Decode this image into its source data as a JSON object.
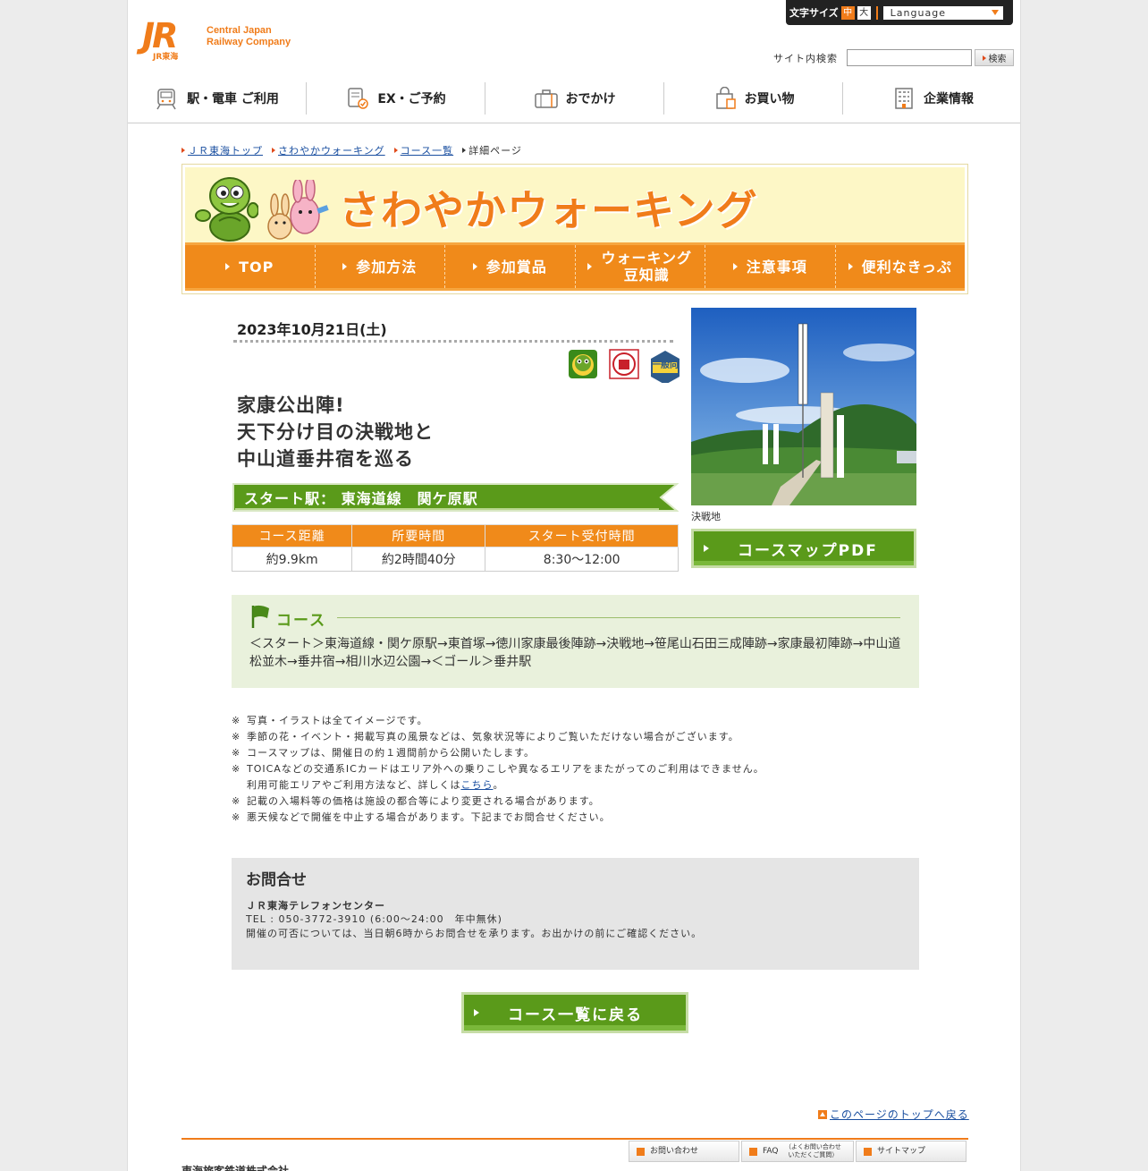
{
  "header": {
    "logo_text_line1": "Central Japan",
    "logo_text_line2": "Railway Company",
    "logo_jr": "JR",
    "logo_small": "JR東海",
    "font_size_label": "文字サイズ",
    "font_size_mid": "中",
    "font_size_large": "大",
    "language_label": "Language",
    "search_label": "サイト内検索",
    "search_value": "",
    "search_button": "検索"
  },
  "global_nav": [
    {
      "label": "駅・電車 ご利用",
      "icon": "train-icon"
    },
    {
      "label": "EX・ご予約",
      "icon": "reservation-icon"
    },
    {
      "label": "おでかけ",
      "icon": "suitcase-icon"
    },
    {
      "label": "お買い物",
      "icon": "shopping-bag-icon"
    },
    {
      "label": "企業情報",
      "icon": "building-icon"
    }
  ],
  "breadcrumb": [
    {
      "label": "ＪＲ東海トップ",
      "link": true
    },
    {
      "label": "さわやかウォーキング",
      "link": true
    },
    {
      "label": "コース一覧",
      "link": true
    },
    {
      "label": "詳細ページ",
      "link": false
    }
  ],
  "banner": {
    "title": "さわやかウォーキング",
    "nav": [
      {
        "line1": "TOP",
        "line2": ""
      },
      {
        "line1": "参加方法",
        "line2": ""
      },
      {
        "line1": "参加賞品",
        "line2": ""
      },
      {
        "line1": "ウォーキング",
        "line2": "豆知識"
      },
      {
        "line1": "注意事項",
        "line2": ""
      },
      {
        "line1": "便利なきっぷ",
        "line2": ""
      }
    ]
  },
  "event": {
    "date": "2023年10月21日(土)",
    "badge_general": "一般向",
    "title_line1": "家康公出陣!",
    "title_line2": "天下分け目の決戦地と",
    "title_line3": "中山道垂井宿を巡る",
    "start_station": "スタート駅： 東海道線　関ケ原駅",
    "table_headers": [
      "コース距離",
      "所要時間",
      "スタート受付時間"
    ],
    "table_values": [
      "約9.9km",
      "約2時間40分",
      "8:30〜12:00"
    ],
    "photo_caption": "決戦地",
    "pdf_button": "コースマップPDF"
  },
  "course": {
    "heading": "コース",
    "route": "＜スタート＞東海道線・関ケ原駅→東首塚→徳川家康最後陣跡→決戦地→笹尾山石田三成陣跡→家康最初陣跡→中山道松並木→垂井宿→相川水辺公園→＜ゴール＞垂井駅"
  },
  "notes": {
    "mark": "※",
    "items": [
      "写真・イラストは全てイメージです。",
      "季節の花・イベント・掲載写真の風景などは、気象状況等によりご覧いただけない場合がございます。",
      "コースマップは、開催日の約１週間前から公開いたします。",
      "TOICAなどの交通系ICカードはエリア外への乗りこしや異なるエリアをまたがってのご利用はできません。",
      "記載の入場料等の価格は施設の都合等により変更される場合があります。",
      "悪天候などで開催を中止する場合があります。下記までお問合せください。"
    ],
    "ic_sub_prefix": "利用可能エリアやご利用方法など、詳しくは",
    "ic_sub_link": "こちら",
    "ic_sub_suffix": "。"
  },
  "contact": {
    "title": "お問合せ",
    "org": "ＪＲ東海テレフォンセンター",
    "tel": "TEL : 050-3772-3910 (6:00～24:00　年中無休)",
    "note": "開催の可否については、当日朝6時からお問合せを承ります。お出かけの前にご確認ください。"
  },
  "back_button": "コース一覧に戻る",
  "to_top": "このページのトップへ戻る",
  "footer": {
    "links": [
      {
        "line1": "お問い合わせ",
        "line2": ""
      },
      {
        "line1": "FAQ",
        "line2": "（よくお問い合わせ いただくご質問）"
      },
      {
        "line1": "サイトマップ",
        "line2": ""
      }
    ],
    "company": "東海旅客鉄道株式会社"
  },
  "colors": {
    "brand_orange": "#f07c1a",
    "green": "#5a9a1a",
    "course_bg": "#e9f1dc",
    "banner_bg": "#fdf7c6"
  }
}
